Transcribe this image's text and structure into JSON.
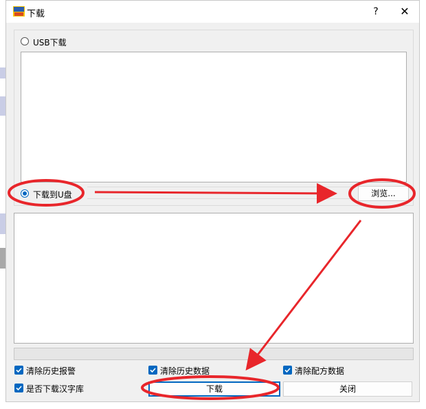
{
  "window": {
    "title": "下载",
    "help_label": "?",
    "close_label": "✕"
  },
  "options": {
    "usb_label": "USB下载",
    "usb_selected": false,
    "udisk_label": "下载到U盘",
    "udisk_selected": true,
    "path_value": "",
    "browse_label": "浏览..."
  },
  "checkboxes": [
    {
      "label": "清除历史报警",
      "checked": true
    },
    {
      "label": "清除历史数据",
      "checked": true
    },
    {
      "label": "清除配方数据",
      "checked": true
    },
    {
      "label": "是否下载汉字库",
      "checked": true
    }
  ],
  "buttons": {
    "download_label": "下载",
    "close_label": "关闭"
  },
  "progress": {
    "value": 0
  },
  "colors": {
    "accent": "#0067c0",
    "annotation": "#e8262b"
  }
}
